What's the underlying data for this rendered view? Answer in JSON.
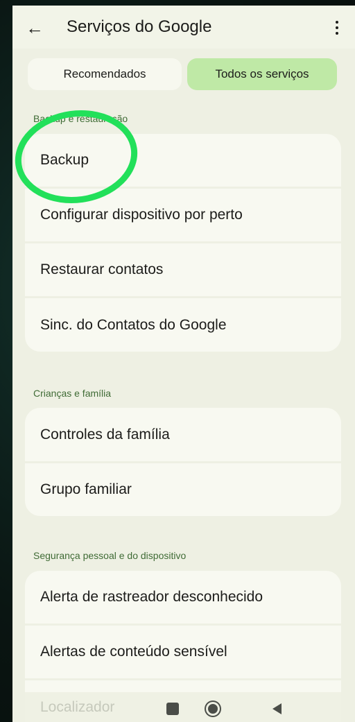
{
  "app_bar": {
    "title": "Serviços do Google",
    "back_icon": "arrow-left-icon",
    "more_icon": "more-vert-icon"
  },
  "tabs": [
    {
      "label": "Recomendados",
      "selected": false
    },
    {
      "label": "Todos os serviços",
      "selected": true
    }
  ],
  "sections": [
    {
      "title": "Backup e restauração",
      "items": [
        "Backup",
        "Configurar dispositivo por perto",
        "Restaurar contatos",
        "Sinc. do Contatos do Google"
      ]
    },
    {
      "title": "Crianças e família",
      "items": [
        "Controles da família",
        "Grupo familiar"
      ]
    },
    {
      "title": "Segurança pessoal e do dispositivo",
      "items": [
        "Alerta de rastreador desconhecido",
        "Alertas de conteúdo sensível",
        "Localizador"
      ]
    }
  ],
  "colors": {
    "accent_tab": "#bfe9a6",
    "section_label": "#3f6b35",
    "highlight": "#22e05a",
    "screen_bg": "#eef0e3"
  },
  "nav_bar": {
    "recent_icon": "recent-apps-icon",
    "home_icon": "home-icon",
    "back_icon": "back-triangle-icon"
  }
}
